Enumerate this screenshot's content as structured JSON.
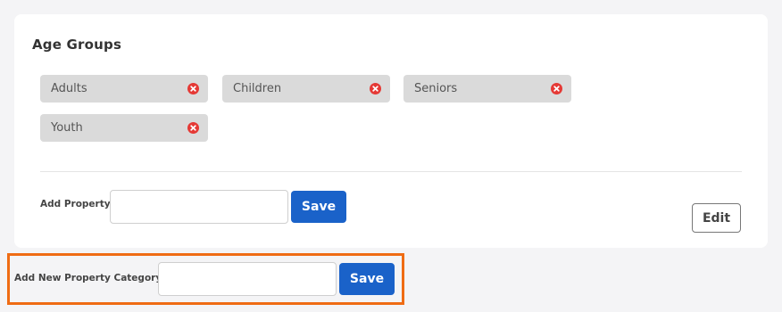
{
  "card": {
    "title": "Age Groups",
    "chips": [
      {
        "label": "Adults"
      },
      {
        "label": "Children"
      },
      {
        "label": "Seniors"
      },
      {
        "label": "Youth"
      }
    ],
    "add_property": {
      "label": "Add Property",
      "value": "",
      "save_label": "Save"
    },
    "edit_label": "Edit"
  },
  "new_category": {
    "label": "Add New Property Category",
    "value": "",
    "save_label": "Save"
  },
  "colors": {
    "primary": "#1a62c9",
    "remove": "#e53935",
    "highlight": "#ef6c14",
    "chip_bg": "#dadada"
  },
  "icons": {
    "chip_remove": "close-circle-icon"
  }
}
